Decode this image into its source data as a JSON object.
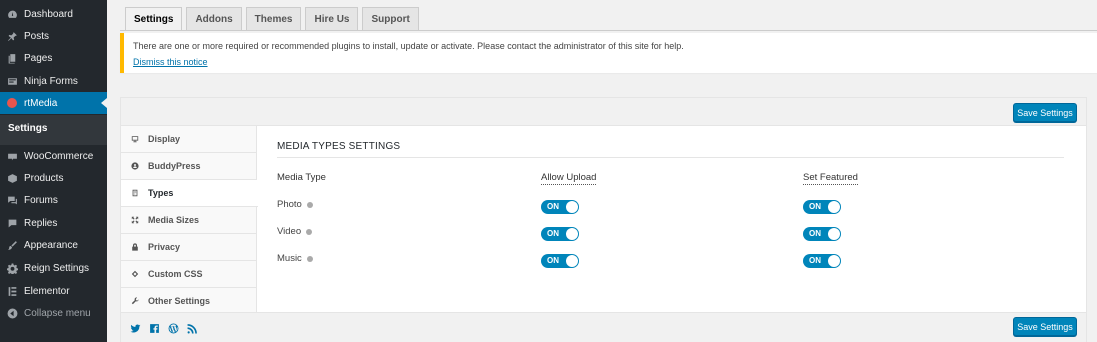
{
  "sidebar": {
    "items": [
      {
        "label": "Dashboard",
        "icon": "dashboard-icon"
      },
      {
        "label": "Posts",
        "icon": "pin-icon"
      },
      {
        "label": "Pages",
        "icon": "pages-icon"
      },
      {
        "label": "Ninja Forms",
        "icon": "form-icon"
      },
      {
        "label": "rtMedia",
        "icon": "rtmedia-icon",
        "current": true
      },
      {
        "label": "WooCommerce",
        "icon": "woocommerce-icon"
      },
      {
        "label": "Products",
        "icon": "products-icon"
      },
      {
        "label": "Forums",
        "icon": "forums-icon"
      },
      {
        "label": "Replies",
        "icon": "replies-icon"
      },
      {
        "label": "Appearance",
        "icon": "brush-icon"
      },
      {
        "label": "Reign Settings",
        "icon": "gear-icon"
      },
      {
        "label": "Elementor",
        "icon": "elementor-icon"
      },
      {
        "label": "Collapse menu",
        "icon": "collapse-icon"
      }
    ],
    "submenu": {
      "label": "Settings"
    }
  },
  "tabs": [
    {
      "label": "Settings",
      "active": true
    },
    {
      "label": "Addons"
    },
    {
      "label": "Themes"
    },
    {
      "label": "Hire Us"
    },
    {
      "label": "Support"
    }
  ],
  "notice": {
    "text": "There are one or more required or recommended plugins to install, update or activate. Please contact the administrator of this site for help.",
    "link": "Dismiss this notice",
    "border_color": "#ffb900"
  },
  "panel": {
    "save_label": "Save Settings",
    "left_nav": [
      {
        "label": "Display",
        "icon": "monitor-icon"
      },
      {
        "label": "BuddyPress",
        "icon": "buddypress-icon"
      },
      {
        "label": "Types",
        "icon": "types-icon",
        "active": true
      },
      {
        "label": "Media Sizes",
        "icon": "resize-icon"
      },
      {
        "label": "Privacy",
        "icon": "lock-icon"
      },
      {
        "label": "Custom CSS",
        "icon": "css-icon"
      },
      {
        "label": "Other Settings",
        "icon": "wrench-icon"
      }
    ],
    "section_title": "MEDIA TYPES SETTINGS",
    "columns": {
      "media_type": "Media Type",
      "allow_upload": "Allow Upload",
      "set_featured": "Set Featured"
    },
    "rows": [
      {
        "label": "Photo",
        "allow_upload": "ON",
        "set_featured": "ON"
      },
      {
        "label": "Video",
        "allow_upload": "ON",
        "set_featured": "ON"
      },
      {
        "label": "Music",
        "allow_upload": "ON",
        "set_featured": "ON"
      }
    ],
    "social": [
      "twitter-icon",
      "facebook-icon",
      "wordpress-icon",
      "rss-icon"
    ]
  },
  "colors": {
    "accent": "#0073aa",
    "button": "#0085ba",
    "sidebar": "#23282d"
  }
}
